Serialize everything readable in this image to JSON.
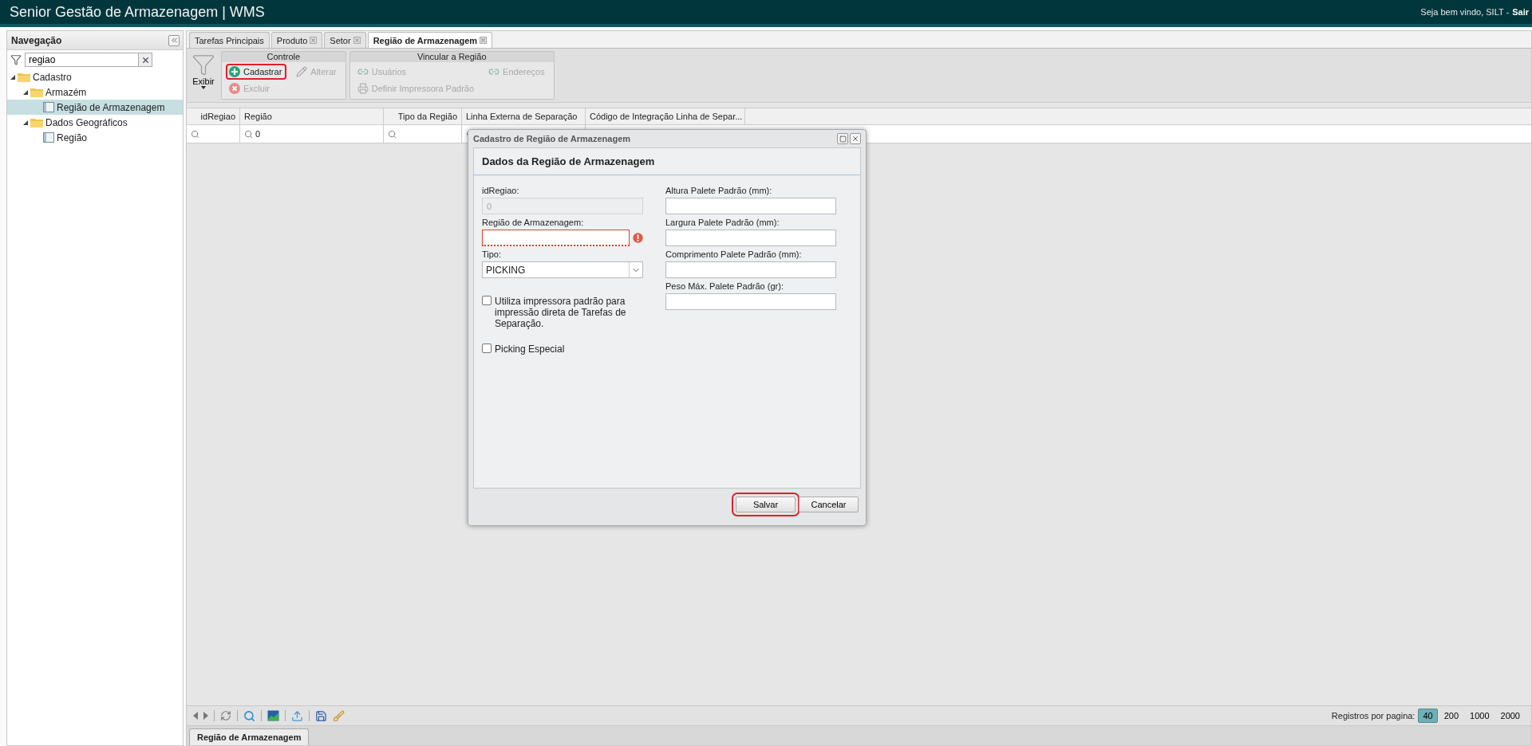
{
  "app": {
    "title": "Senior Gestão de Armazenagem | WMS",
    "greeting": "Seja bem vindo, SILT -",
    "logout": "Sair"
  },
  "navigation": {
    "title": "Navegação",
    "search": {
      "value": "regiao"
    },
    "tree": [
      {
        "label": "Cadastro",
        "kind": "folder",
        "expanded": true,
        "selected": false,
        "children": [
          {
            "label": "Armazém",
            "kind": "folder",
            "expanded": true,
            "selected": false,
            "children": [
              {
                "label": "Região de Armazenagem",
                "kind": "screen",
                "selected": true
              }
            ]
          },
          {
            "label": "Dados Geográficos",
            "kind": "folder",
            "expanded": true,
            "selected": false,
            "children": [
              {
                "label": "Região",
                "kind": "screen",
                "selected": false
              }
            ]
          }
        ]
      }
    ]
  },
  "tabs": [
    {
      "label": "Tarefas Principais",
      "selected": false,
      "closable": false
    },
    {
      "label": "Produto",
      "selected": false,
      "closable": true
    },
    {
      "label": "Setor",
      "selected": false,
      "closable": true
    },
    {
      "label": "Região de Armazenagem",
      "selected": true,
      "closable": true
    }
  ],
  "toolbar": {
    "view_button": "Exibir",
    "groups": [
      {
        "title": "Controle",
        "buttons": [
          {
            "label": "Cadastrar",
            "kind": "add",
            "disabled": false,
            "highlighted": true
          },
          {
            "label": "Alterar",
            "kind": "edit",
            "disabled": true,
            "highlighted": false
          },
          {
            "label": "Excluir",
            "kind": "delete",
            "disabled": true,
            "highlighted": false
          }
        ]
      },
      {
        "title": "Vincular a Região",
        "buttons": [
          {
            "label": "Usuários",
            "kind": "link",
            "disabled": true,
            "highlighted": false
          },
          {
            "label": "Endereços",
            "kind": "link",
            "disabled": true,
            "highlighted": false
          },
          {
            "label": "Definir Impressora Padrão",
            "kind": "printer",
            "disabled": true,
            "highlighted": false
          }
        ]
      }
    ]
  },
  "grid": {
    "columns": [
      {
        "label": "idRegiao"
      },
      {
        "label": "Região",
        "filter": "0"
      },
      {
        "label": "Tipo da Região"
      },
      {
        "label": "Linha Externa de Separação"
      },
      {
        "label": "Código de Integração Linha de Separ..."
      }
    ]
  },
  "dialog": {
    "title": "Cadastro de Região de Armazenagem",
    "section_title": "Dados da Região de Armazenagem",
    "left_fields": [
      {
        "kind": "text",
        "label": "idRegiao:",
        "value": "0",
        "disabled": true,
        "invalid": false
      },
      {
        "kind": "text",
        "label": "Região de Armazenagem:",
        "disabled": false,
        "invalid": true
      },
      {
        "kind": "select",
        "label": "Tipo:",
        "value": "PICKING"
      },
      {
        "kind": "checkbox",
        "label": "Utiliza impressora padrão para impressão direta de Tarefas de Separação.",
        "checked": false
      },
      {
        "kind": "checkbox",
        "label": "Picking Especial",
        "checked": false
      }
    ],
    "right_fields": [
      {
        "kind": "text",
        "label": "Altura Palete Padrão (mm):",
        "disabled": false,
        "invalid": false
      },
      {
        "kind": "text",
        "label": "Largura Palete Padrão (mm):",
        "disabled": false,
        "invalid": false
      },
      {
        "kind": "text",
        "label": "Comprimento Palete Padrão (mm):",
        "disabled": false,
        "invalid": false
      },
      {
        "kind": "text",
        "label": "Peso Máx. Palete Padrão (gr):",
        "disabled": false,
        "invalid": false
      }
    ],
    "buttons": [
      {
        "label": "Salvar",
        "highlighted": true
      },
      {
        "label": "Cancelar",
        "highlighted": false
      }
    ]
  },
  "pager": {
    "page_size_label": "Registros por pagina:",
    "page_sizes": [
      {
        "label": "40",
        "selected": true
      },
      {
        "label": "200",
        "selected": false
      },
      {
        "label": "1000",
        "selected": false
      },
      {
        "label": "2000",
        "selected": false
      }
    ]
  },
  "bottom_tab": {
    "label": "Região de Armazenagem"
  }
}
